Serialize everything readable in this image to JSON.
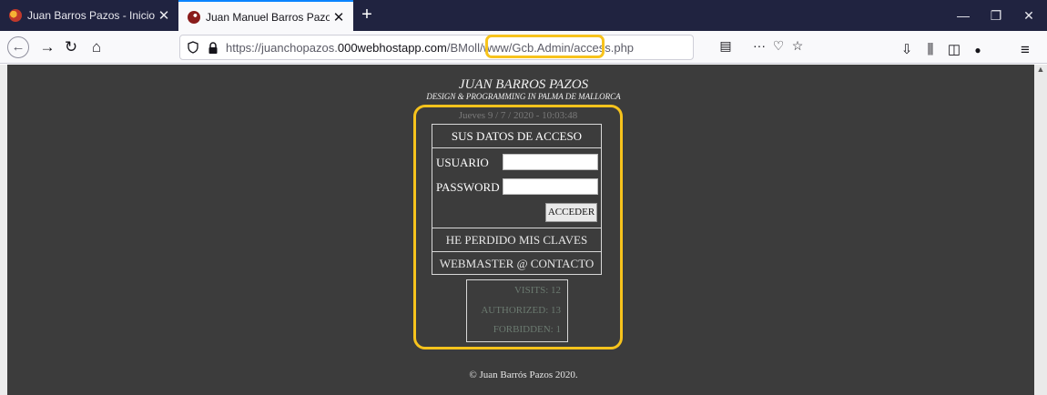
{
  "tabs": [
    {
      "title": "Juan Barros Pazos - Inicio",
      "close": "✕"
    },
    {
      "title": "Juan Manuel Barros Pazos",
      "close": "✕"
    }
  ],
  "new_tab_glyph": "+",
  "window_controls": {
    "minimize": "—",
    "restore": "❐",
    "close": "✕"
  },
  "nav": {
    "back": "←",
    "forward": "→",
    "reload": "↻",
    "home": "⌂"
  },
  "url": {
    "prefix": "https://juanchopazos.",
    "domain": "000webhostapp.com",
    "path": "/BMoll/www/Gcb.Admin/access.php"
  },
  "url_actions": {
    "reader": "▤",
    "more": "···",
    "pocket": "♡",
    "bookmark": "☆"
  },
  "toolbar": {
    "downloads": "⇩",
    "library": "⫼",
    "sidebar": "◫",
    "account": "●",
    "menu": "≡"
  },
  "page": {
    "site_title": "JUAN BARROS PAZOS",
    "site_subtitle": "DESIGN & PROGRAMMING IN PALMA DE MALLORCA",
    "date": "Jueves 9 / 7 / 2020 - 10:03:48",
    "login": {
      "heading": "SUS DATOS DE ACCESO",
      "user_label": "USUARIO",
      "user_value": "",
      "password_label": "PASSWORD",
      "password_value": "",
      "submit": "ACCEDER",
      "lost_keys": "HE PERDIDO MIS CLAVES",
      "contact": "WEBMASTER @ CONTACTO"
    },
    "stats": {
      "visits": "VISITS:  12",
      "authorized": "AUTHORIZED:  13",
      "forbidden": "FORBIDDEN:   1"
    },
    "footer": "© Juan Barrós Pazos 2020."
  },
  "colors": {
    "highlight": "#f7c31c",
    "page_bg": "#3c3c3c",
    "tabstrip_bg": "#202340"
  }
}
